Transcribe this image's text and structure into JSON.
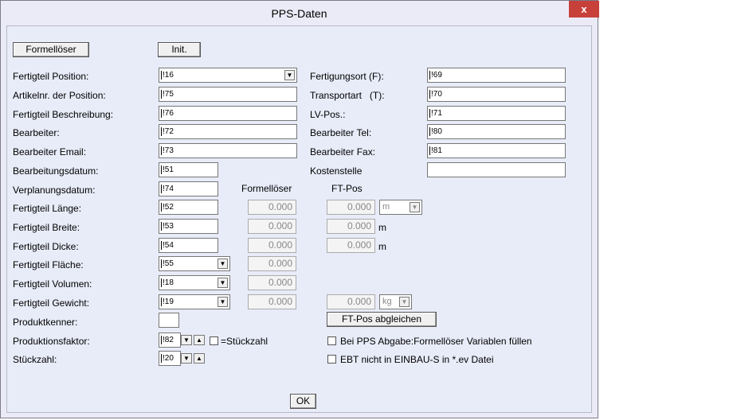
{
  "window": {
    "title": "PPS-Daten",
    "close_label": "x"
  },
  "buttons": {
    "formelloeser": "Formellöser",
    "init": "Init.",
    "ftpos_abgleichen": "FT-Pos abgleichen",
    "ok": "OK"
  },
  "left": {
    "fertigteil_position": {
      "label": "Fertigteil Position:",
      "value": "!16"
    },
    "artikelnr": {
      "label": "Artikelnr. der Position:",
      "value": "!75"
    },
    "beschreibung": {
      "label": "Fertigteil Beschreibung:",
      "value": "!76"
    },
    "bearbeiter": {
      "label": "Bearbeiter:",
      "value": "!72"
    },
    "bearbeiter_email": {
      "label": "Bearbeiter Email:",
      "value": "!73"
    },
    "bearbeitungsdatum": {
      "label": "Bearbeitungsdatum:",
      "value": "!51"
    },
    "verplanungsdatum": {
      "label": "Verplanungsdatum:",
      "value": "!74"
    },
    "laenge": {
      "label": "Fertigteil Länge:",
      "value": "!52"
    },
    "breite": {
      "label": "Fertigteil Breite:",
      "value": "!53"
    },
    "dicke": {
      "label": "Fertigteil Dicke:",
      "value": "!54"
    },
    "flaeche": {
      "label": "Fertigteil Fläche:",
      "value": "!55"
    },
    "volumen": {
      "label": "Fertigteil Volumen:",
      "value": "!18"
    },
    "gewicht": {
      "label": "Fertigteil Gewicht:",
      "value": "!19"
    },
    "produktkenner": {
      "label": "Produktkenner:",
      "value": ""
    },
    "produktionsfaktor": {
      "label": "Produktionsfaktor:",
      "value": "!82"
    },
    "stueckzahl": {
      "label": "Stückzahl:",
      "value": "!20"
    }
  },
  "right": {
    "fertigungsort": {
      "label": "Fertigungsort (F):",
      "value": "!69"
    },
    "transportart": {
      "label": "Transportart   (T):",
      "value": "!70"
    },
    "lvpos": {
      "label": "LV-Pos.:",
      "value": "!71"
    },
    "bearbeiter_tel": {
      "label": "Bearbeiter Tel:",
      "value": "!80"
    },
    "bearbeiter_fax": {
      "label": "Bearbeiter Fax:",
      "value": "!81"
    },
    "kostenstelle": {
      "label": "Kostenstelle",
      "value": ""
    }
  },
  "columns": {
    "formelloeser": "Formellöser",
    "ftpos": "FT-Pos"
  },
  "formel_values": {
    "laenge": "0.000",
    "breite": "0.000",
    "dicke": "0.000",
    "flaeche": "0.000",
    "volumen": "0.000",
    "gewicht": "0.000"
  },
  "ftpos_values": {
    "laenge": "0.000",
    "breite": "0.000",
    "dicke": "0.000",
    "gewicht": "0.000"
  },
  "units": {
    "laenge": "m",
    "breite": "m",
    "dicke": "m",
    "gewicht": "kg"
  },
  "checkboxes": {
    "stueckzahl": {
      "label": "=Stückzahl",
      "checked": false
    },
    "pps_abgabe": {
      "label": "Bei PPS Abgabe:Formellöser Variablen füllen",
      "checked": false
    },
    "ebt": {
      "label": "EBT nicht in EINBAU-S in *.ev Datei",
      "checked": false
    }
  },
  "colors": {
    "close": "#c7403a",
    "window_bg": "#e8ecf8"
  }
}
